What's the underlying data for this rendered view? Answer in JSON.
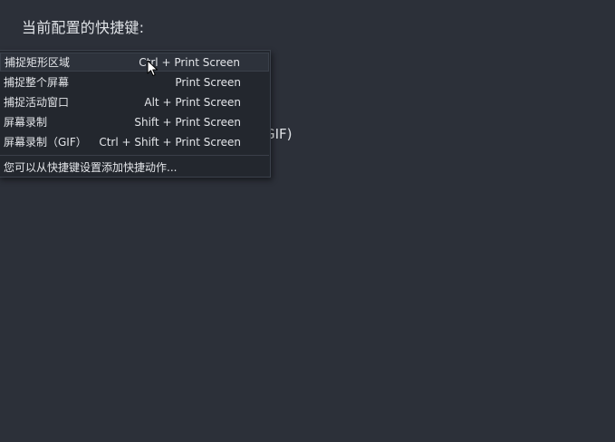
{
  "page": {
    "title": "当前配置的快捷键:",
    "behind_text": "GIF)"
  },
  "menu": {
    "items": [
      {
        "label": "捕捉矩形区域",
        "shortcut": "Ctrl + Print Screen"
      },
      {
        "label": "捕捉整个屏幕",
        "shortcut": "Print Screen"
      },
      {
        "label": "捕捉活动窗口",
        "shortcut": "Alt + Print Screen"
      },
      {
        "label": "屏幕录制",
        "shortcut": "Shift + Print Screen"
      },
      {
        "label": "屏幕录制（GIF）",
        "shortcut": "Ctrl + Shift + Print Screen"
      }
    ],
    "footer": "您可以从快捷键设置添加快捷动作..."
  },
  "colors": {
    "background": "#2c3039",
    "menu_background": "#23272e",
    "hover_background": "#2d323b"
  },
  "icons": {
    "cursor": "mouse-pointer-icon"
  }
}
